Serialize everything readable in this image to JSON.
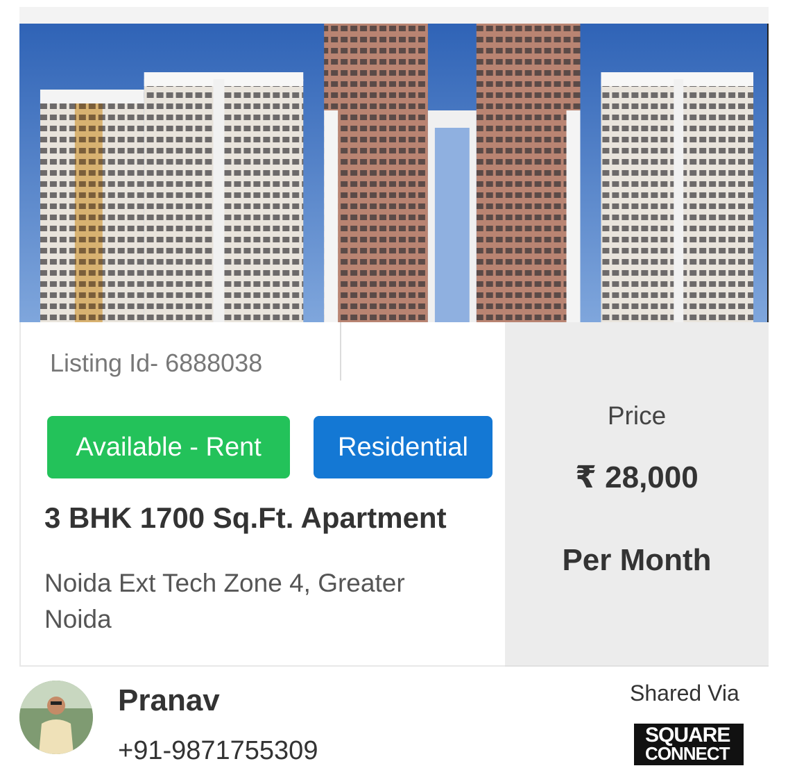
{
  "listing": {
    "id_label": "Listing Id- 6888038",
    "status_badge": "Available - Rent",
    "type_badge": "Residential",
    "title": "3 BHK 1700 Sq.Ft. Apartment",
    "address": "Noida Ext Tech Zone 4, Greater Noida",
    "image_alt": "building-photo"
  },
  "price": {
    "label": "Price",
    "value": "₹ 28,000",
    "period": "Per Month"
  },
  "agent": {
    "name": "Pranav",
    "phone": "+91-9871755309"
  },
  "footer": {
    "shared_via": "Shared Via",
    "logo_line1": "SQUARE",
    "logo_line2": "CONNECT"
  },
  "colors": {
    "available": "#23c25a",
    "residential": "#1478d4",
    "price_bg": "#ececec"
  }
}
